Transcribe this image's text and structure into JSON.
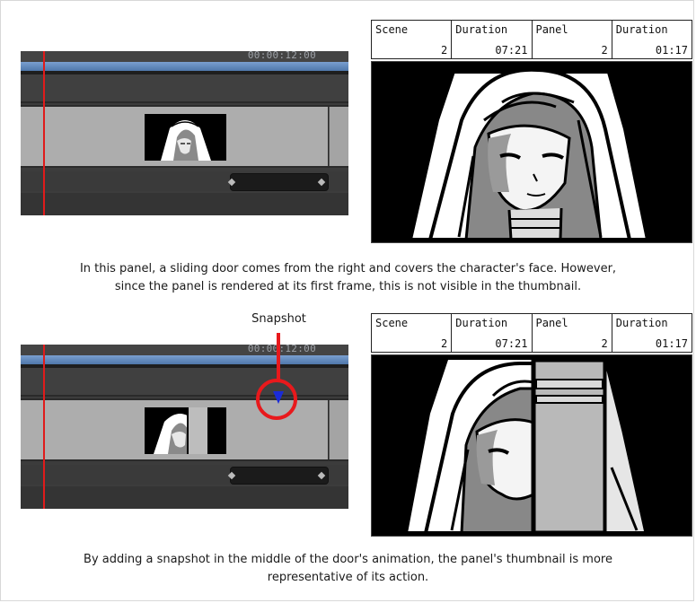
{
  "top": {
    "timecode": "00:00:12:00",
    "info": [
      {
        "label": "Scene",
        "value": "2"
      },
      {
        "label": "Duration",
        "value": "07:21"
      },
      {
        "label": "Panel",
        "value": "2"
      },
      {
        "label": "Duration",
        "value": "01:17"
      }
    ],
    "caption_lines": [
      "In this panel, a sliding door comes from the right and covers the character's face. However,",
      "since the panel is rendered at its first frame, this is not visible in the thumbnail."
    ]
  },
  "bottom": {
    "timecode": "00:00:12:00",
    "snapshot_label": "Snapshot",
    "info": [
      {
        "label": "Scene",
        "value": "2"
      },
      {
        "label": "Duration",
        "value": "07:21"
      },
      {
        "label": "Panel",
        "value": "2"
      },
      {
        "label": "Duration",
        "value": "01:17"
      }
    ],
    "caption_lines": [
      "By adding a snapshot in the middle of the door's animation, the panel's thumbnail is more",
      "representative of its action."
    ]
  },
  "colors": {
    "playhead": "#e01b1b",
    "callout": "#e8191c",
    "snapshot_marker": "#1a2bd8",
    "timeline_bar": "#6a8fc4"
  },
  "icons": {
    "snapshot_marker": "snapshot-marker-icon",
    "keyframe": "keyframe-diamond-icon"
  }
}
